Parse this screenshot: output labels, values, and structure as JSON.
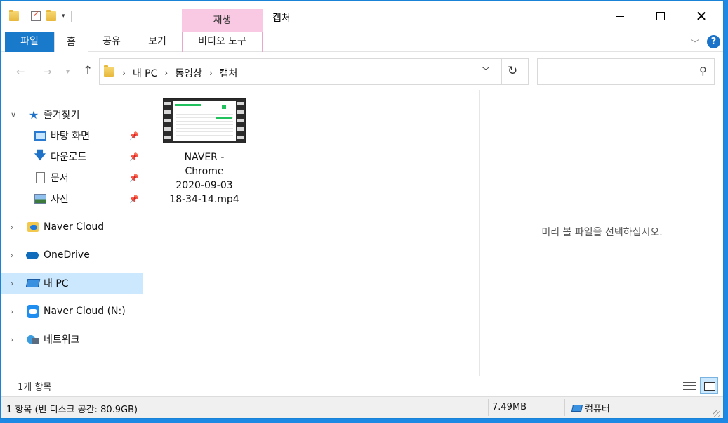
{
  "window": {
    "title": "캡처",
    "context_tab": "재생"
  },
  "ribbon": {
    "tabs": [
      "파일",
      "홈",
      "공유",
      "보기",
      "비디오 도구"
    ],
    "help": "?"
  },
  "address": {
    "crumbs": [
      "내 PC",
      "동영상",
      "캡처"
    ],
    "search_placeholder": ""
  },
  "nav_pane": {
    "quick_access": "즐겨찾기",
    "items": [
      {
        "label": "바탕 화면",
        "icon": "desktop-icon",
        "pinned": true
      },
      {
        "label": "다운로드",
        "icon": "download-icon",
        "pinned": true
      },
      {
        "label": "문서",
        "icon": "document-icon",
        "pinned": true
      },
      {
        "label": "사진",
        "icon": "picture-icon",
        "pinned": true
      }
    ],
    "roots": [
      {
        "label": "Naver Cloud",
        "icon": "naver-cloud-folder-icon"
      },
      {
        "label": "OneDrive",
        "icon": "onedrive-icon"
      },
      {
        "label": "내 PC",
        "icon": "this-pc-icon",
        "selected": true
      },
      {
        "label": "Naver Cloud (N:)",
        "icon": "naver-cloud-drive-icon"
      },
      {
        "label": "네트워크",
        "icon": "network-icon"
      }
    ]
  },
  "files": [
    {
      "name": "NAVER -\nChrome\n2020-09-03\n18-34-14.mp4",
      "icon": "video-thumbnail"
    }
  ],
  "preview": {
    "message": "미리 볼 파일을 선택하십시오."
  },
  "item_count": "1개 항목",
  "status": {
    "summary": "1 항목 (빈 디스크 공간: 80.9GB)",
    "size": "7.49MB",
    "location": "컴퓨터"
  },
  "colors": {
    "file_tab": "#1979ca",
    "context_tab": "#f9c8e2",
    "selection": "#cce8ff",
    "accent": "#1e73c9"
  }
}
